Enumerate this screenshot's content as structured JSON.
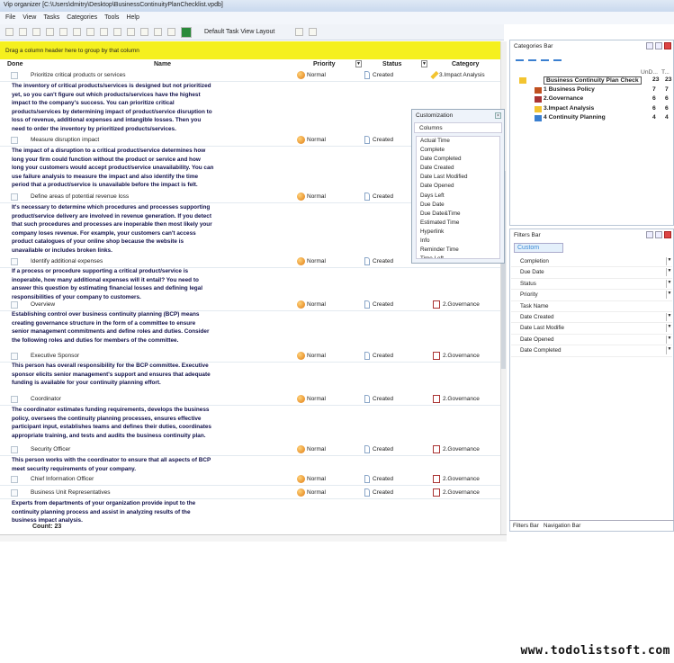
{
  "window": {
    "title": "Vip organizer [C:\\Users\\dmitry\\Desktop\\BusinessContinuityPlanChecklist.vpdb]"
  },
  "menu": [
    "File",
    "View",
    "Tasks",
    "Categories",
    "Tools",
    "Help"
  ],
  "toolbar": {
    "layout": "Default Task View Layout"
  },
  "grid": {
    "group_hint": "Drag a column header here to group by that column",
    "columns": {
      "done": "Done",
      "name": "Name",
      "priority": "Priority",
      "status": "Status",
      "category": "Category"
    },
    "rows": [
      {
        "name": "Prioritize critical products or services",
        "priority": "Normal",
        "status": "Created",
        "category": "3.Impact Analysis",
        "note": "The inventory of critical products/services is designed but not prioritized yet, so you can't figure out which products/services have the highest impact to the company's success. You can prioritize critical products/services by determining impact of product/service disruption to loss of revenue, additional expenses and intangible losses. Then you need to order the inventory by prioritized products/services."
      },
      {
        "name": "Measure disruption impact",
        "priority": "Normal",
        "status": "Created",
        "category": "",
        "note": "The impact of a disruption to a critical product/service determines how long your firm could function without the product or service and how long your customers would accept product/service unavailability. You can use failure analysis to measure the impact and also identify the time period that a product/service is unavailable before the impact is felt."
      },
      {
        "name": "Define areas of potential revenue loss",
        "priority": "Normal",
        "status": "Created",
        "category": "",
        "note": "It's necessary to determine which procedures and processes supporting product/service delivery are involved in revenue generation. If you detect that such procedures and processes are inoperable then most likely your company loses revenue. For example, your customers can't access product catalogues of your online shop because the website is unavailable or includes broken links."
      },
      {
        "name": "Identify additional expenses",
        "priority": "Normal",
        "status": "Created",
        "category": "",
        "note": "If a process or procedure supporting a critical product/service is inoperable, how many additional expenses will it entail? You need to answer this question by estimating financial losses and defining legal responsibilities of your company to customers."
      },
      {
        "name": "Overview",
        "priority": "Normal",
        "status": "Created",
        "category": "2.Governance",
        "note": "Establishing control over business continuity planning (BCP) means creating governance structure in the form of a committee to ensure senior management commitments and define roles and duties. Consider the following roles and duties for members of the committee."
      },
      {
        "name": "Executive Sponsor",
        "priority": "Normal",
        "status": "Created",
        "category": "2.Governance",
        "note": "This person has overall responsibility for the BCP committee. Executive sponsor elicits senior management's support and ensures that adequate funding is available for your continuity planning effort."
      },
      {
        "name": "Coordinator",
        "priority": "Normal",
        "status": "Created",
        "category": "2.Governance",
        "note": "The coordinator estimates funding requirements, develops the business policy, oversees the continuity planning processes, ensures effective participant input, establishes teams and defines their duties, coordinates appropriate training, and tests and audits the business continuity plan."
      },
      {
        "name": "Security Officer",
        "priority": "Normal",
        "status": "Created",
        "category": "2.Governance",
        "note": "This person works with the coordinator to ensure that all aspects of BCP meet security requirements of your company."
      },
      {
        "name": "Chief Information Officer",
        "priority": "Normal",
        "status": "Created",
        "category": "2.Governance",
        "note": ""
      },
      {
        "name": "Business Unit Representatives",
        "priority": "Normal",
        "status": "Created",
        "category": "2.Governance",
        "note": "Experts from departments of your organization provide input to the continuity planning process and assist in analyzing results of the business impact analysis."
      }
    ],
    "count": "Count: 23"
  },
  "customization": {
    "title": "Customization",
    "tab": "Columns",
    "items": [
      "Actual Time",
      "Complete",
      "Date Completed",
      "Date Created",
      "Date Last Modified",
      "Date Opened",
      "Days Left",
      "Due Date",
      "Due Date&Time",
      "Estimated Time",
      "Hyperlink",
      "Info",
      "Reminder Time",
      "Time Left"
    ]
  },
  "categories_bar": {
    "title": "Categories Bar",
    "col1": "UnD...",
    "col2": "T...",
    "items": [
      {
        "name": "Business Continuity Plan Check",
        "undone": "23",
        "total": "23"
      },
      {
        "name": "1 Business Policy",
        "undone": "7",
        "total": "7"
      },
      {
        "name": "2.Governance",
        "undone": "6",
        "total": "6"
      },
      {
        "name": "3.Impact Analysis",
        "undone": "6",
        "total": "6"
      },
      {
        "name": "4 Continuity Planning",
        "undone": "4",
        "total": "4"
      }
    ]
  },
  "filters_bar": {
    "title": "Filters Bar",
    "preset": "Custom",
    "fields": [
      "Completion",
      "Due Date",
      "Status",
      "Priority",
      "Task Name",
      "Date Created",
      "Date Last Modifie",
      "Date Opened",
      "Date Completed"
    ]
  },
  "bottom_tabs": [
    "Filters Bar",
    "Navigation Bar"
  ],
  "watermark": "www.todolistsoft.com",
  "colors": {
    "group_bar": "#f5f01e",
    "note_text": "#10104a",
    "accent": "#3b8ad6"
  }
}
